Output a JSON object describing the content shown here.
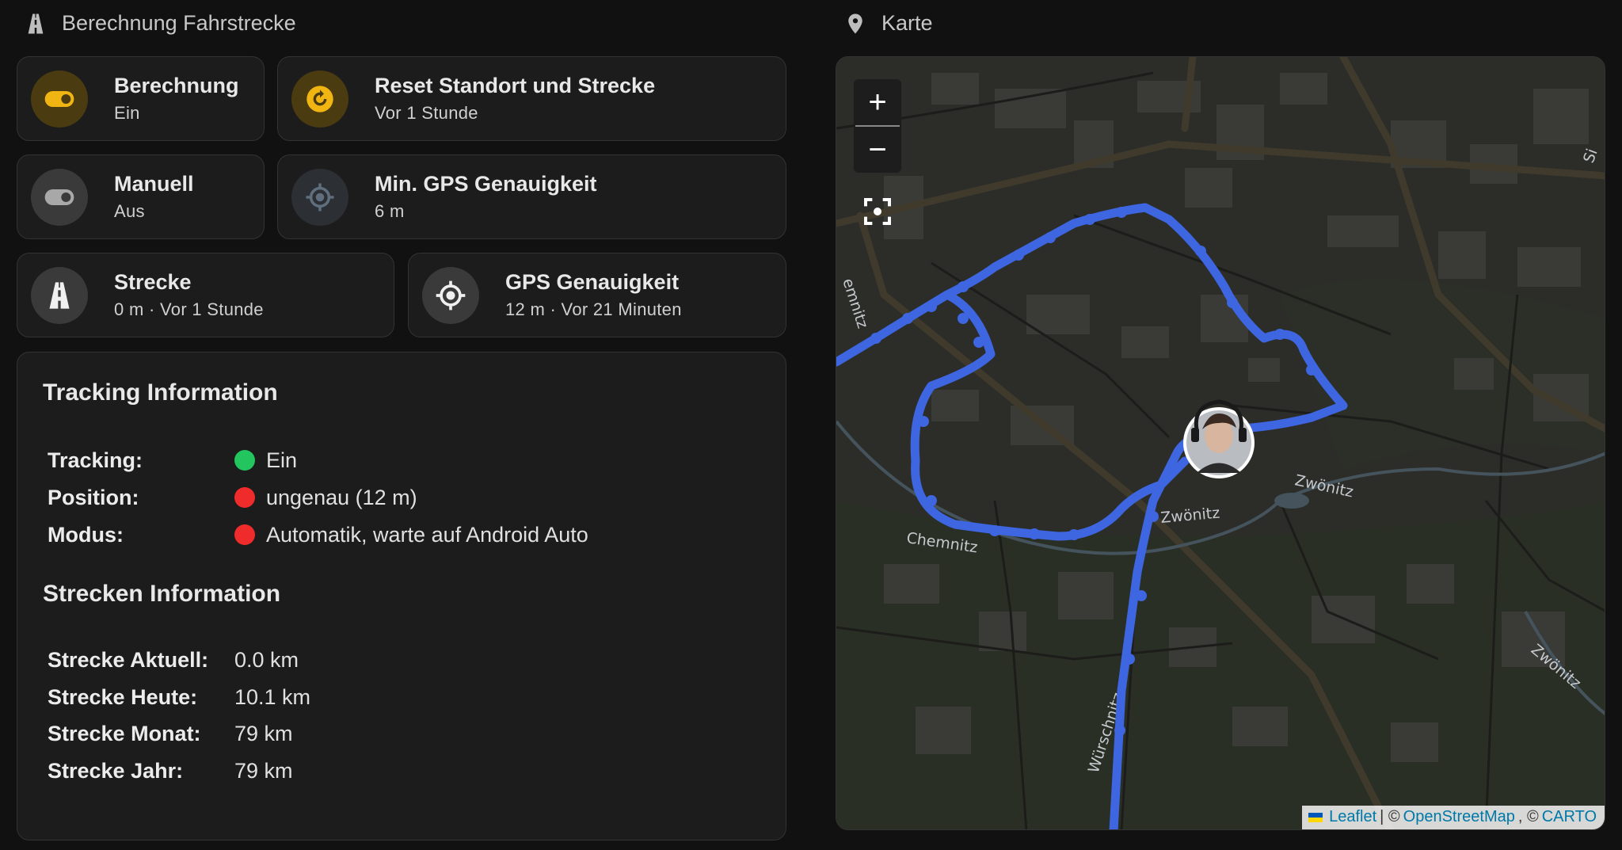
{
  "left_section": {
    "title": "Berechnung Fahrstrecke",
    "icon": "road-icon"
  },
  "right_section": {
    "title": "Karte",
    "icon": "map-marker-icon"
  },
  "tiles": {
    "berechnung": {
      "title": "Berechnung",
      "state": "Ein",
      "icon": "toggle-on-icon",
      "color": "#f0b513"
    },
    "reset": {
      "title": "Reset Standort und Strecke",
      "state": "Vor 1 Stunde",
      "icon": "reset-icon",
      "color": "#f0b513"
    },
    "manuell": {
      "title": "Manuell",
      "state": "Aus",
      "icon": "toggle-off-icon"
    },
    "min_gps": {
      "title": "Min. GPS Genauigkeit",
      "state": "6 m",
      "icon": "crosshairs-gps-icon"
    },
    "strecke": {
      "title": "Strecke",
      "state": "0 m · Vor 1 Stunde",
      "icon": "road-icon"
    },
    "gps": {
      "title": "GPS Genauigkeit",
      "state": "12 m · Vor 21 Minuten",
      "icon": "crosshairs-gps-icon"
    }
  },
  "tracking": {
    "heading": "Tracking Information",
    "rows": [
      {
        "label": "Tracking:",
        "value": "Ein",
        "status_color": "#22c55e"
      },
      {
        "label": "Position:",
        "value": "ungenau (12 m)",
        "status_color": "#ef2b2b"
      },
      {
        "label": "Modus:",
        "value": "Automatik, warte auf Android Auto",
        "status_color": "#ef2b2b"
      }
    ]
  },
  "strecken": {
    "heading": "Strecken Information",
    "rows": [
      {
        "label": "Strecke Aktuell:",
        "value": "0.0 km"
      },
      {
        "label": "Strecke Heute:",
        "value": "10.1 km"
      },
      {
        "label": "Strecke Monat:",
        "value": "79 km"
      },
      {
        "label": "Strecke Jahr:",
        "value": "79 km"
      }
    ]
  },
  "map": {
    "zoom_in": "+",
    "zoom_out": "−",
    "labels": {
      "river_1": "Zwönitz",
      "river_2": "Chemnitz",
      "river_3": "Zwönitz",
      "river_4": "Zwönitz",
      "river_5": "emnitz",
      "street_1": "Würschnitz",
      "edge": "Si"
    },
    "attribution": {
      "leaflet": "Leaflet",
      "sep1": "| ©",
      "osm": "OpenStreetMap",
      "sep2": ", ©",
      "carto": "CARTO"
    },
    "track_color": "#3d66e0"
  }
}
